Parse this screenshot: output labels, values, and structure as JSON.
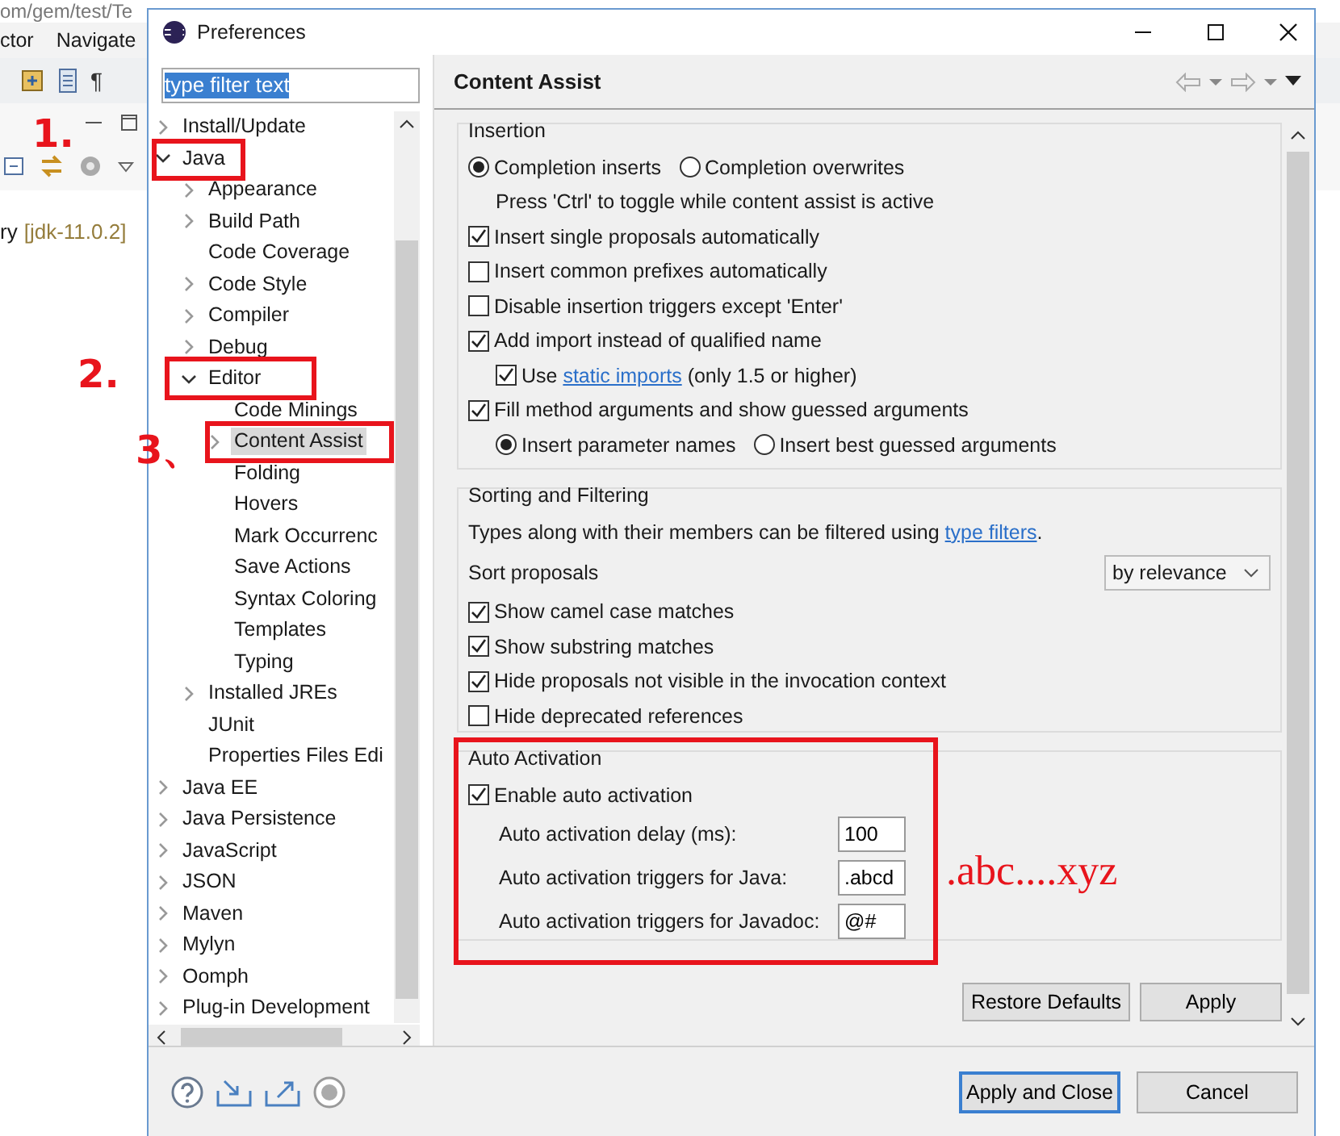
{
  "ide": {
    "title": "om/gem/test/Te",
    "menu": [
      "ctor",
      "Navigate"
    ],
    "toolbar_glyph": "¶",
    "project_name": "ry",
    "project_decoration": "[jdk-11.0.2]"
  },
  "window": {
    "title": "Preferences"
  },
  "filter": {
    "value": "type filter text",
    "text_selected": true
  },
  "tree": [
    {
      "label": "Install/Update",
      "kind": "collapsed",
      "selected": false,
      "highlighted": false
    },
    {
      "label": "Java",
      "kind": "expanded",
      "selected": false,
      "highlighted": true,
      "annotation": "1.",
      "children": [
        {
          "label": "Appearance",
          "kind": "collapsed",
          "selected": false,
          "highlighted": false
        },
        {
          "label": "Build Path",
          "kind": "collapsed",
          "selected": false,
          "highlighted": false
        },
        {
          "label": "Code Coverage",
          "kind": "leaf",
          "selected": false,
          "highlighted": false
        },
        {
          "label": "Code Style",
          "kind": "collapsed",
          "selected": false,
          "highlighted": false
        },
        {
          "label": "Compiler",
          "kind": "collapsed",
          "selected": false,
          "highlighted": false
        },
        {
          "label": "Debug",
          "kind": "collapsed",
          "selected": false,
          "highlighted": false
        },
        {
          "label": "Editor",
          "kind": "expanded",
          "selected": false,
          "highlighted": true,
          "annotation": "2.",
          "children": [
            {
              "label": "Code Minings",
              "kind": "leaf",
              "selected": false,
              "highlighted": false
            },
            {
              "label": "Content Assist",
              "kind": "collapsed",
              "selected": true,
              "highlighted": true,
              "annotation": "3、"
            },
            {
              "label": "Folding",
              "kind": "leaf",
              "selected": false,
              "highlighted": false
            },
            {
              "label": "Hovers",
              "kind": "leaf",
              "selected": false,
              "highlighted": false
            },
            {
              "label": "Mark Occurrenc",
              "kind": "leaf",
              "selected": false,
              "highlighted": false
            },
            {
              "label": "Save Actions",
              "kind": "leaf",
              "selected": false,
              "highlighted": false
            },
            {
              "label": "Syntax Coloring",
              "kind": "leaf",
              "selected": false,
              "highlighted": false
            },
            {
              "label": "Templates",
              "kind": "leaf",
              "selected": false,
              "highlighted": false
            },
            {
              "label": "Typing",
              "kind": "leaf",
              "selected": false,
              "highlighted": false
            }
          ]
        },
        {
          "label": "Installed JREs",
          "kind": "collapsed",
          "selected": false,
          "highlighted": false
        },
        {
          "label": "JUnit",
          "kind": "leaf",
          "selected": false,
          "highlighted": false
        },
        {
          "label": "Properties Files Edi",
          "kind": "leaf",
          "selected": false,
          "highlighted": false
        }
      ]
    },
    {
      "label": "Java EE",
      "kind": "collapsed",
      "selected": false,
      "highlighted": false
    },
    {
      "label": "Java Persistence",
      "kind": "collapsed",
      "selected": false,
      "highlighted": false
    },
    {
      "label": "JavaScript",
      "kind": "collapsed",
      "selected": false,
      "highlighted": false
    },
    {
      "label": "JSON",
      "kind": "collapsed",
      "selected": false,
      "highlighted": false
    },
    {
      "label": "Maven",
      "kind": "collapsed",
      "selected": false,
      "highlighted": false
    },
    {
      "label": "Mylyn",
      "kind": "collapsed",
      "selected": false,
      "highlighted": false
    },
    {
      "label": "Oomph",
      "kind": "collapsed",
      "selected": false,
      "highlighted": false
    },
    {
      "label": "Plug-in Development",
      "kind": "collapsed",
      "selected": false,
      "highlighted": false
    }
  ],
  "page": {
    "title": "Content Assist"
  },
  "insertion": {
    "title": "Insertion",
    "rows": [
      {
        "kind": "radios",
        "options": [
          {
            "label": "Completion inserts",
            "selected": true
          },
          {
            "label": "Completion overwrites",
            "selected": false
          }
        ]
      },
      {
        "kind": "hint",
        "text": "Press 'Ctrl' to toggle while content assist is active"
      },
      {
        "kind": "checkbox",
        "label": "Insert single proposals automatically",
        "checked": true
      },
      {
        "kind": "checkbox",
        "label": "Insert common prefixes automatically",
        "checked": false
      },
      {
        "kind": "checkbox",
        "label": "Disable insertion triggers except 'Enter'",
        "checked": false
      },
      {
        "kind": "checkbox",
        "label": "Add import instead of qualified name",
        "checked": true,
        "children": [
          {
            "kind": "checkbox",
            "label": "Use",
            "link": "static imports",
            "suffix": "(only 1.5 or higher)",
            "checked": true
          }
        ]
      },
      {
        "kind": "checkbox",
        "label": "Fill method arguments and show guessed arguments",
        "checked": true,
        "children": [
          {
            "kind": "radios",
            "options": [
              {
                "label": "Insert parameter names",
                "selected": true
              },
              {
                "label": "Insert best guessed arguments",
                "selected": false
              }
            ]
          }
        ]
      }
    ]
  },
  "sorting": {
    "title": "Sorting and Filtering",
    "text": "Types along with their members can be filtered using",
    "link": "type filters",
    "after_link": ".",
    "sort_label": "Sort proposals",
    "sort_value": "by relevance",
    "rows": [
      {
        "kind": "checkbox",
        "label": "Show camel case matches",
        "checked": true
      },
      {
        "kind": "checkbox",
        "label": "Show substring matches",
        "checked": true
      },
      {
        "kind": "checkbox",
        "label": "Hide proposals not visible in the invocation context",
        "checked": true
      },
      {
        "kind": "checkbox",
        "label": "Hide deprecated references",
        "checked": false
      }
    ]
  },
  "auto": {
    "title": "Auto Activation",
    "highlighted": true,
    "note": ".abc....xyz",
    "enable": {
      "label": "Enable auto activation",
      "checked": true
    },
    "fields": [
      {
        "label": "Auto activation delay (ms):",
        "value": "100"
      },
      {
        "label": "Auto activation triggers for Java:",
        "value": ".abcd"
      },
      {
        "label": "Auto activation triggers for Javadoc:",
        "value": "@#"
      }
    ]
  },
  "page_buttons": [
    "Restore Defaults",
    "Apply"
  ],
  "dialog_buttons": [
    {
      "label": "Apply and Close",
      "default": true
    },
    {
      "label": "Cancel",
      "default": false
    }
  ]
}
